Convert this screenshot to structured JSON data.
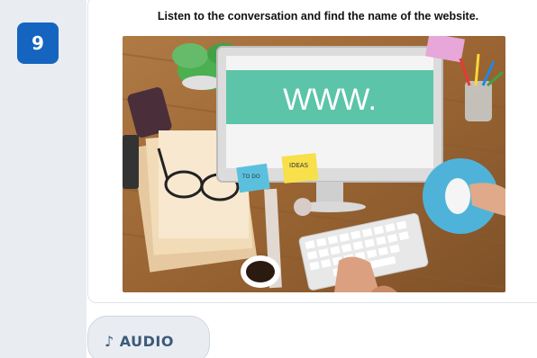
{
  "question": {
    "number": "9",
    "instruction": "Listen to the conversation and find the name of the website.",
    "photo": {
      "screen_text": "WWW.",
      "sticky_note_1": "IDEAS",
      "sticky_note_2": "TO DO"
    }
  },
  "audio": {
    "icon": "music-note-icon",
    "label": "AUDIO"
  },
  "colors": {
    "badge": "#1565c0",
    "rail": "#e9edf2",
    "screen": "#5cc4a8"
  }
}
